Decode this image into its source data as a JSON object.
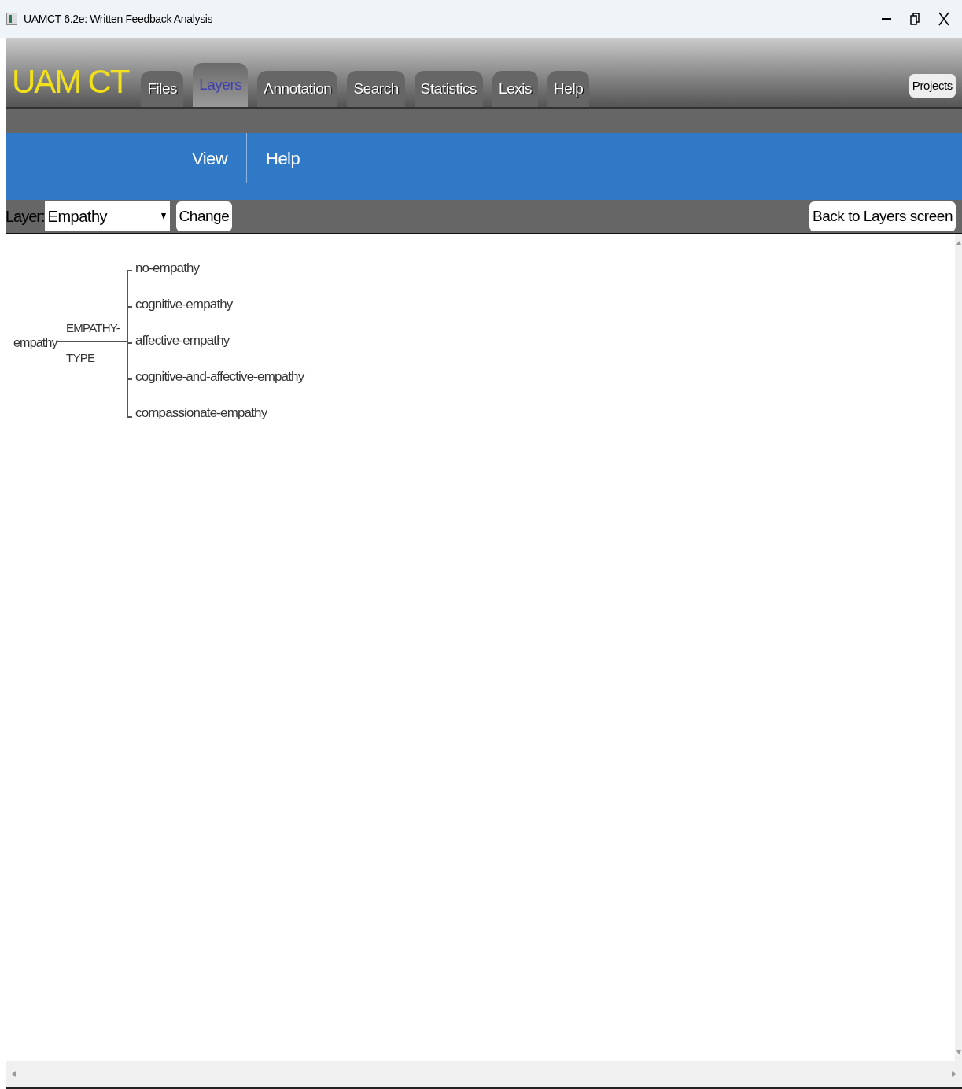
{
  "window": {
    "title": "UAMCT 6.2e: Written Feedback Analysis"
  },
  "brand": "UAM CT",
  "tabs": [
    {
      "label": "Files",
      "selected": false
    },
    {
      "label": "Layers",
      "selected": true
    },
    {
      "label": "Annotation",
      "selected": false
    },
    {
      "label": "Search",
      "selected": false
    },
    {
      "label": "Statistics",
      "selected": false
    },
    {
      "label": "Lexis",
      "selected": false
    },
    {
      "label": "Help",
      "selected": false
    }
  ],
  "projects_button": "Projects",
  "submenu": [
    "View",
    "Help"
  ],
  "layer_bar": {
    "label": "Layer:",
    "select": {
      "value": "Empathy"
    },
    "change_button": "Change",
    "back_button": "Back to Layers screen"
  },
  "tree": {
    "root": "empathy",
    "system_lines": [
      "EMPATHY-",
      "TYPE"
    ],
    "features": [
      "no-empathy",
      "cognitive-empathy",
      "affective-empathy",
      "cognitive-and-affective-empathy",
      "compassionate-empathy"
    ]
  }
}
